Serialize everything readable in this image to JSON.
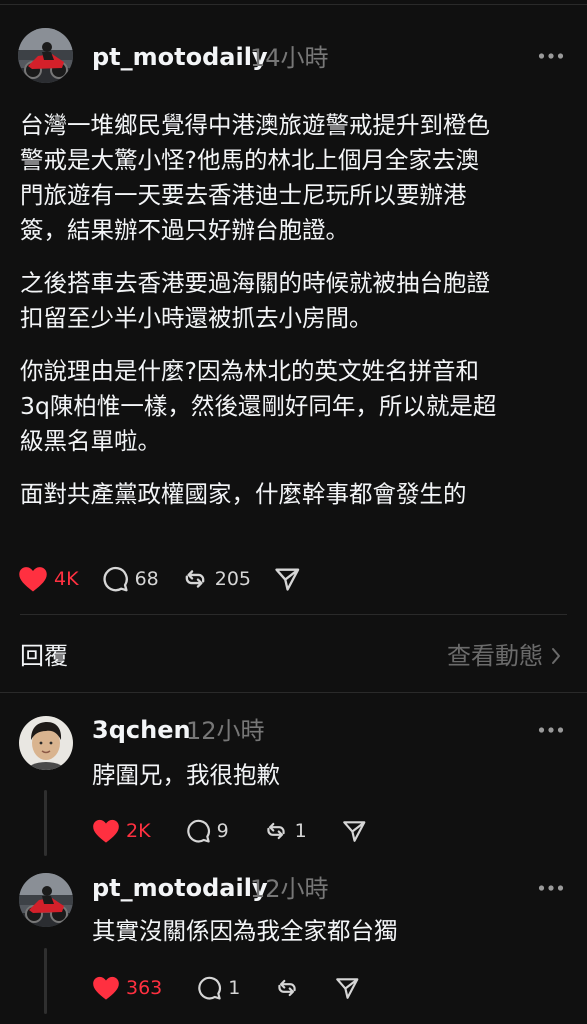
{
  "post": {
    "username": "pt_motodaily",
    "timestamp": "14小時",
    "paragraphs": [
      [
        "台灣一堆鄉民覺得中港澳旅遊警戒提升到橙色",
        "警戒是大驚小怪?他馬的林北上個月全家去澳",
        "門旅遊有一天要去香港迪士尼玩所以要辦港",
        "簽，結果辦不過只好辦台胞證。"
      ],
      [
        "之後搭車去香港要過海關的時候就被抽台胞證",
        "扣留至少半小時還被抓去小房間。"
      ],
      [
        "你說理由是什麼?因為林北的英文姓名拼音和",
        "3q陳柏惟一樣，然後還剛好同年，所以就是超",
        "級黑名單啦。"
      ],
      [
        "面對共產黨政權國家，什麼幹事都會發生的"
      ]
    ],
    "likes": "4K",
    "comments": "68",
    "reposts": "205"
  },
  "replies_section": {
    "label": "回覆",
    "view_activity": "查看動態"
  },
  "replies": [
    {
      "username": "3qchen",
      "timestamp": "12小時",
      "text": "脖圍兄，我很抱歉",
      "likes": "2K",
      "comments": "9",
      "reposts": "1"
    },
    {
      "username": "pt_motodaily",
      "timestamp": "12小時",
      "text": "其實沒關係因為我全家都台獨",
      "likes": "363",
      "comments": "1",
      "reposts": ""
    }
  ],
  "colors": {
    "background": "#101010",
    "text": "#f3f5f7",
    "muted": "#777777",
    "like_red": "#ff3040",
    "divider": "#2a2a2a"
  },
  "icons": [
    "heart-icon",
    "comment-icon",
    "repost-icon",
    "share-icon",
    "more-icon",
    "chevron-right-icon"
  ]
}
